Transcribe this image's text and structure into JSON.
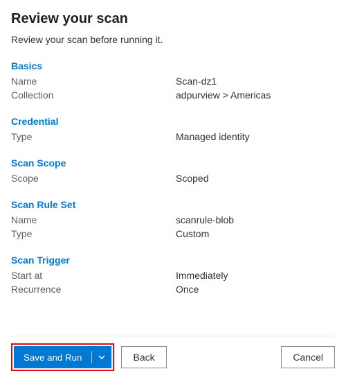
{
  "header": {
    "title": "Review your scan",
    "subtitle": "Review your scan before running it."
  },
  "sections": {
    "basics": {
      "title": "Basics",
      "name_label": "Name",
      "name_value": "Scan-dz1",
      "collection_label": "Collection",
      "collection_value": "adpurview > Americas"
    },
    "credential": {
      "title": "Credential",
      "type_label": "Type",
      "type_value": "Managed identity"
    },
    "scope": {
      "title": "Scan Scope",
      "scope_label": "Scope",
      "scope_value": "Scoped"
    },
    "ruleset": {
      "title": "Scan Rule Set",
      "name_label": "Name",
      "name_value": "scanrule-blob",
      "type_label": "Type",
      "type_value": "Custom"
    },
    "trigger": {
      "title": "Scan Trigger",
      "start_label": "Start at",
      "start_value": "Immediately",
      "recurrence_label": "Recurrence",
      "recurrence_value": "Once"
    }
  },
  "footer": {
    "save_run_label": "Save and Run",
    "back_label": "Back",
    "cancel_label": "Cancel"
  }
}
